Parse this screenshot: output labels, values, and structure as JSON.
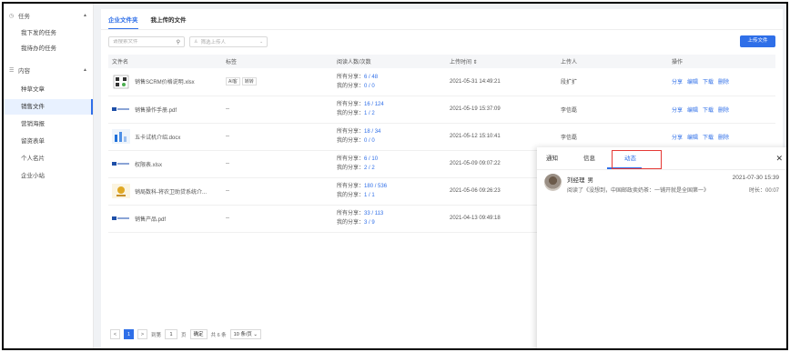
{
  "sidebar": {
    "groups": [
      {
        "label": "任务",
        "icon": "clock-icon",
        "items": [
          "我下发的任务",
          "我待办的任务"
        ]
      },
      {
        "label": "内容",
        "icon": "list-icon",
        "items": [
          "种草文章",
          "销售文件",
          "营销海报",
          "留资表单",
          "个人名片",
          "企业小站"
        ]
      }
    ],
    "active_item": "销售文件"
  },
  "main": {
    "tabs": [
      "企业文件夹",
      "我上传的文件"
    ],
    "active_tab": "企业文件夹",
    "search_placeholder": "请搜索文件",
    "uploader_placeholder": "筛选上传人",
    "upload_button": "上传文件",
    "columns": [
      "文件名",
      "标签",
      "阅读人数/次数",
      "上传时间 ⇕",
      "上传人",
      "操作"
    ],
    "share_all_label": "所有分享：",
    "share_mine_label": "我的分享：",
    "ops": [
      "分享",
      "编辑",
      "下载",
      "删除"
    ],
    "rows": [
      {
        "name": "销售SCRM价格说明.xlsx",
        "thumb": "qrcode-thumb",
        "tags": [
          "AI客",
          "转转"
        ],
        "all": "6 / 48",
        "mine": "0 / 0",
        "time": "2021-05-31 14:49:21",
        "uploader": "段扩扩"
      },
      {
        "name": "销售操作手册.pdf",
        "thumb": "banner-thumb",
        "tags": [],
        "tag_text": "--",
        "all": "16 / 124",
        "mine": "1 / 2",
        "time": "2021-05-19 15:37:09",
        "uploader": "李信磊"
      },
      {
        "name": "五卡试机介绍.docx",
        "thumb": "chart-thumb",
        "tags": [],
        "tag_text": "--",
        "all": "18 / 34",
        "mine": "0 / 0",
        "time": "2021-05-12 15:10:41",
        "uploader": "李信磊"
      },
      {
        "name": "权限表.xlsx",
        "thumb": "banner-thumb",
        "tags": [],
        "tag_text": "--",
        "all": "6 / 10",
        "mine": "2 / 2",
        "time": "2021-05-09 09:07:22",
        "uploader": "李信磊"
      },
      {
        "name": "销局数科-将农卫助贷系统介...",
        "thumb": "logo-thumb",
        "tags": [],
        "tag_text": "--",
        "all": "180 / 536",
        "mine": "1 / 1",
        "time": "2021-05-06 09:26:23",
        "uploader": "李信磊"
      },
      {
        "name": "销售产品.pdf",
        "thumb": "banner-thumb",
        "tags": [],
        "tag_text": "--",
        "all": "33 / 113",
        "mine": "3 / 9",
        "time": "2021-04-13 09:49:18",
        "uploader": "李信磊"
      }
    ],
    "pager": {
      "prev": "<",
      "current": "1",
      "next": ">",
      "goto_label": "到第",
      "goto_value": "1",
      "page_unit": "页",
      "confirm": "确定",
      "total": "共 6 条",
      "page_size": "10 条/页"
    }
  },
  "panel": {
    "tabs": [
      "通知",
      "信息",
      "动态"
    ],
    "active_tab": "动态",
    "activity": {
      "name": "刘经理",
      "gender": "男",
      "desc": "阅读了《没想到，中国邮政卖奶茶：一铺开就是全国第一》",
      "time": "2021-07-30 15:39",
      "duration": "时长：00:07"
    }
  },
  "colors": {
    "accent": "#2f6fe8",
    "highlight_box": "#e53935",
    "scroll_thumb": "#2e7d32"
  }
}
